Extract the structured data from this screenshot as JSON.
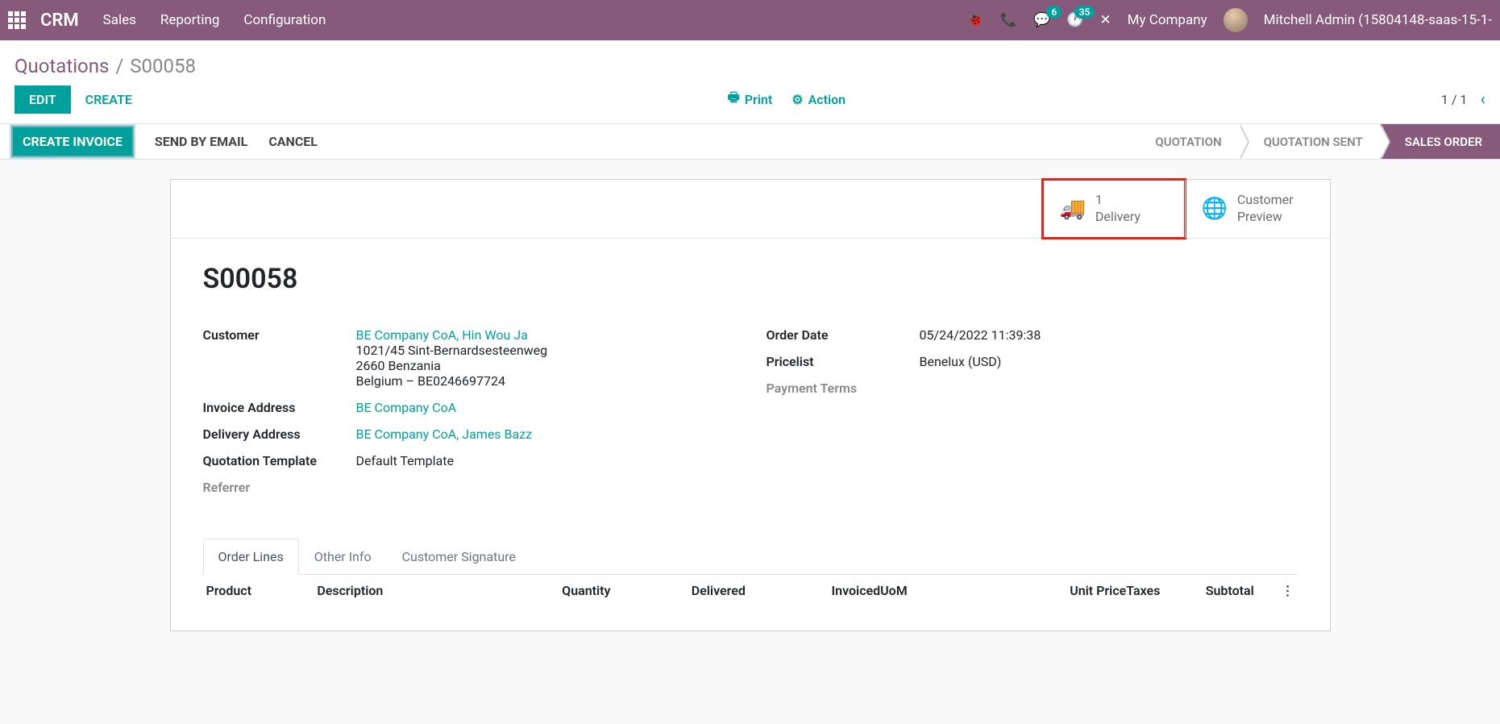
{
  "navbar": {
    "brand": "CRM",
    "menu": [
      "Sales",
      "Reporting",
      "Configuration"
    ],
    "messages_badge": "6",
    "activities_badge": "35",
    "company": "My Company",
    "user": "Mitchell Admin (15804148-saas-15-1-"
  },
  "breadcrumb": {
    "parent": "Quotations",
    "current": "S00058"
  },
  "controls": {
    "edit": "EDIT",
    "create": "CREATE",
    "print": "Print",
    "action": "Action",
    "pager": "1 / 1"
  },
  "actions": {
    "create_invoice": "CREATE INVOICE",
    "send_email": "SEND BY EMAIL",
    "cancel": "CANCEL"
  },
  "status": {
    "quotation": "QUOTATION",
    "quotation_sent": "QUOTATION SENT",
    "sales_order": "SALES ORDER"
  },
  "stat_buttons": {
    "delivery_count": "1",
    "delivery_label": "Delivery",
    "preview_line1": "Customer",
    "preview_line2": "Preview"
  },
  "order": {
    "name": "S00058",
    "labels": {
      "customer": "Customer",
      "invoice_address": "Invoice Address",
      "delivery_address": "Delivery Address",
      "quotation_template": "Quotation Template",
      "referrer": "Referrer",
      "order_date": "Order Date",
      "pricelist": "Pricelist",
      "payment_terms": "Payment Terms"
    },
    "customer_link": "BE Company CoA, Hin Wou Ja",
    "customer_addr1": "1021/45 Sint-Bernardsesteenweg",
    "customer_addr2": "2660 Benzania",
    "customer_addr3": "Belgium – BE0246697724",
    "invoice_address": "BE Company CoA",
    "delivery_address": "BE Company CoA, James Bazz",
    "quotation_template": "Default Template",
    "order_date": "05/24/2022 11:39:38",
    "pricelist": "Benelux (USD)"
  },
  "tabs": {
    "order_lines": "Order Lines",
    "other_info": "Other Info",
    "signature": "Customer Signature"
  },
  "columns": {
    "product": "Product",
    "description": "Description",
    "quantity": "Quantity",
    "delivered": "Delivered",
    "invoiced": "Invoiced",
    "uom": "UoM",
    "unit_price": "Unit Price",
    "taxes": "Taxes",
    "subtotal": "Subtotal"
  }
}
